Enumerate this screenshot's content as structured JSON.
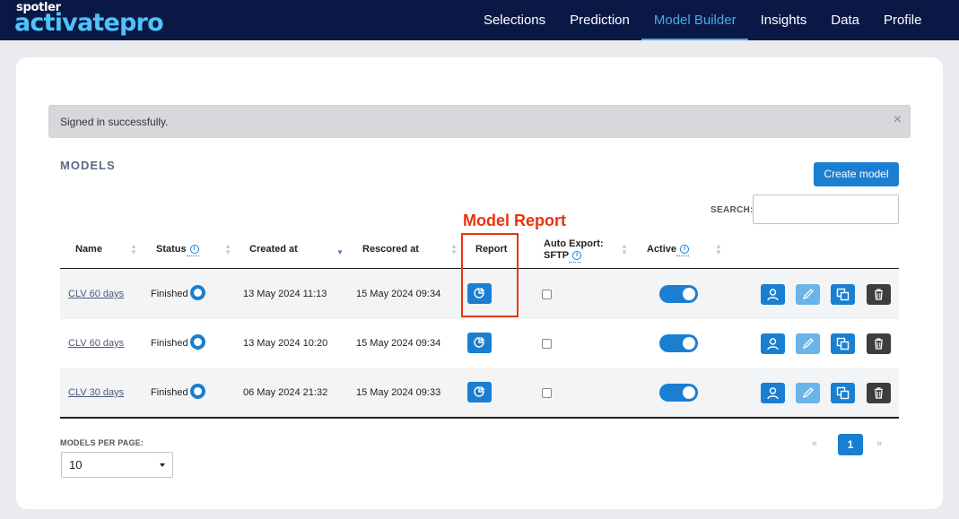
{
  "brand": {
    "top": "spotler",
    "main": "activatepro"
  },
  "nav": {
    "items": [
      {
        "label": "Selections"
      },
      {
        "label": "Prediction"
      },
      {
        "label": "Model Builder"
      },
      {
        "label": "Insights"
      },
      {
        "label": "Data"
      },
      {
        "label": "Profile"
      }
    ],
    "active": "Model Builder"
  },
  "alert": {
    "text": "Signed in successfully.",
    "close": "×"
  },
  "models": {
    "title": "MODELS",
    "create_label": "Create model",
    "search_label": "SEARCH:",
    "search_value": "",
    "annotation": "Model Report",
    "columns": {
      "name": "Name",
      "status": "Status",
      "created": "Created at",
      "rescored": "Rescored at",
      "report": "Report",
      "auto_export_1": "Auto Export:",
      "auto_export_2": "SFTP",
      "active": "Active"
    },
    "rows": [
      {
        "name": "CLV 60 days",
        "status": "Finished",
        "created": "13 May 2024 11:13",
        "rescored": "15 May 2024 09:34",
        "auto_export": false,
        "active": true
      },
      {
        "name": "CLV 60 days",
        "status": "Finished",
        "created": "13 May 2024 10:20",
        "rescored": "15 May 2024 09:34",
        "auto_export": false,
        "active": true
      },
      {
        "name": "CLV 30 days",
        "status": "Finished",
        "created": "06 May 2024 21:32",
        "rescored": "15 May 2024 09:33",
        "auto_export": false,
        "active": true
      }
    ],
    "per_page_label": "MODELS PER PAGE:",
    "per_page_value": "10",
    "pagination": {
      "first": "«",
      "current": "1",
      "last": "»"
    }
  },
  "colors": {
    "nav_bg": "#0a1846",
    "accent": "#1a7fd1",
    "logo": "#4fc3f7",
    "annotation": "#e8340f",
    "delete": "#3d3d3d"
  }
}
